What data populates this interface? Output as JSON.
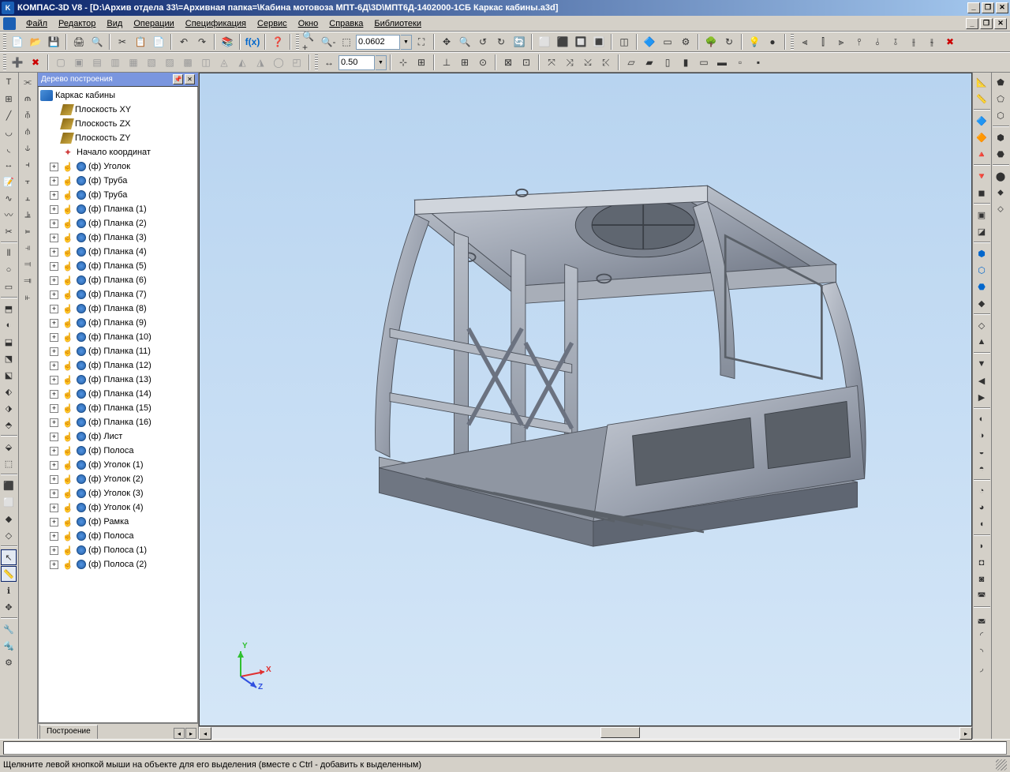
{
  "title": "КОМПАС-3D V8 - [D:\\Архив отдела 33\\=Архивная папка=\\Кабина мотовоза МПТ-6Д\\3D\\МПТ6Д-1402000-1СБ Каркас кабины.a3d]",
  "menubar": {
    "file": "Файл",
    "editor": "Редактор",
    "view": "Вид",
    "operations": "Операции",
    "spec": "Спецификация",
    "service": "Сервис",
    "window": "Окно",
    "help": "Справка",
    "libs": "Библиотеки"
  },
  "toolbar": {
    "zoom_value": "0.0602",
    "step_value": "0.50"
  },
  "tree": {
    "title": "Дерево построения",
    "root": "Каркас кабины",
    "plane_xy": "Плоскость XY",
    "plane_zx": "Плоскость ZX",
    "plane_zy": "Плоскость ZY",
    "origin": "Начало координат",
    "items": [
      "(ф) Уголок",
      "(ф) Труба",
      "(ф) Труба",
      "(ф) Планка (1)",
      "(ф) Планка (2)",
      "(ф) Планка (3)",
      "(ф) Планка (4)",
      "(ф) Планка (5)",
      "(ф) Планка (6)",
      "(ф) Планка (7)",
      "(ф) Планка (8)",
      "(ф) Планка (9)",
      "(ф) Планка (10)",
      "(ф) Планка (11)",
      "(ф) Планка (12)",
      "(ф) Планка (13)",
      "(ф) Планка (14)",
      "(ф) Планка (15)",
      "(ф) Планка (16)",
      "(ф) Лист",
      "(ф) Полоса",
      "(ф) Уголок (1)",
      "(ф) Уголок (2)",
      "(ф) Уголок (3)",
      "(ф) Уголок (4)",
      "(ф) Рамка",
      "(ф) Полоса",
      "(ф) Полоса (1)",
      "(ф) Полоса (2)"
    ],
    "tab": "Построение"
  },
  "axis": {
    "x": "X",
    "y": "Y",
    "z": "Z"
  },
  "status": "Щелкните левой кнопкой мыши на объекте для его выделения (вместе с Ctrl - добавить к выделенным)"
}
